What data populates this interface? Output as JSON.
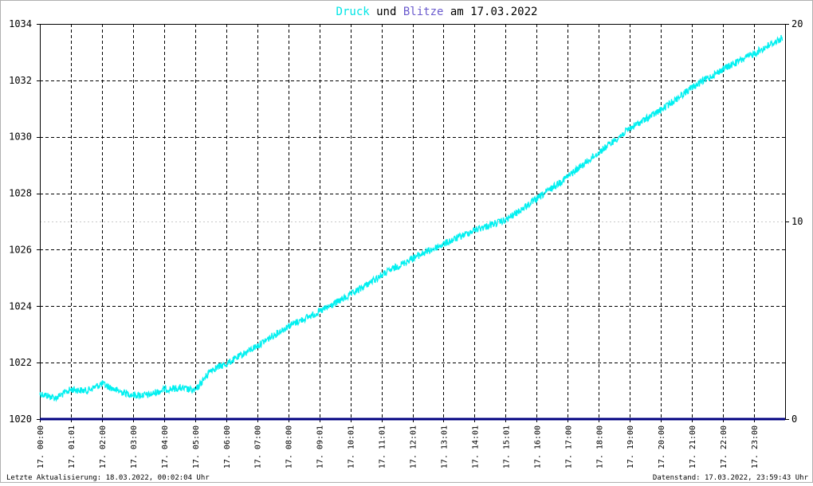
{
  "chart_data": {
    "type": "line",
    "title_parts": [
      "Druck",
      " und ",
      "Blitze",
      " am 17.03.2022"
    ],
    "title_colors": [
      "#00e5e5",
      "#000000",
      "#6a5acd",
      "#000000"
    ],
    "y_left_ticks": [
      "1020",
      "1022",
      "1024",
      "1026",
      "1028",
      "1030",
      "1032",
      "1034"
    ],
    "y_left_range": [
      1020,
      1034
    ],
    "y_right_ticks": [
      "0",
      "10",
      "20"
    ],
    "y_right_range": [
      0,
      20
    ],
    "x_range_hours": [
      0,
      24
    ],
    "x_ticks": [
      "17. 00:00",
      "17. 01:01",
      "17. 02:00",
      "17. 03:00",
      "17. 04:00",
      "17. 05:00",
      "17. 06:00",
      "17. 07:00",
      "17. 08:00",
      "17. 09:01",
      "17. 10:01",
      "17. 11:01",
      "17. 12:01",
      "17. 13:01",
      "17. 14:01",
      "17. 15:01",
      "17. 16:00",
      "17. 17:00",
      "17. 18:00",
      "17. 19:00",
      "17. 20:00",
      "17. 21:00",
      "17. 22:00",
      "17. 23:00"
    ],
    "grid": true,
    "series": [
      {
        "name": "Druck",
        "color": "#00f0f0",
        "axis": "left",
        "x_hours": [
          0,
          0.5,
          1,
          1.5,
          2,
          2.5,
          3,
          3.5,
          4,
          4.5,
          5,
          5.5,
          6,
          7,
          8,
          9,
          10,
          11,
          12,
          13,
          14,
          15,
          16,
          17,
          18,
          19,
          20,
          21,
          22,
          23,
          23.9
        ],
        "values": [
          1020.9,
          1020.75,
          1021.05,
          1021.0,
          1021.25,
          1021.0,
          1020.85,
          1020.85,
          1021.05,
          1021.1,
          1021.0,
          1021.75,
          1021.95,
          1022.6,
          1023.3,
          1023.8,
          1024.4,
          1025.1,
          1025.7,
          1026.2,
          1026.7,
          1027.05,
          1027.8,
          1028.6,
          1029.45,
          1030.3,
          1030.95,
          1031.75,
          1032.4,
          1032.95,
          1033.5
        ]
      },
      {
        "name": "Blitze",
        "color": "#000080",
        "axis": "right",
        "x_hours": [
          0,
          24
        ],
        "values": [
          0,
          0
        ]
      }
    ]
  },
  "footer": {
    "left": "Letzte Aktualisierung: 18.03.2022, 00:02:04 Uhr",
    "right": "Datenstand: 17.03.2022, 23:59:43 Uhr"
  }
}
